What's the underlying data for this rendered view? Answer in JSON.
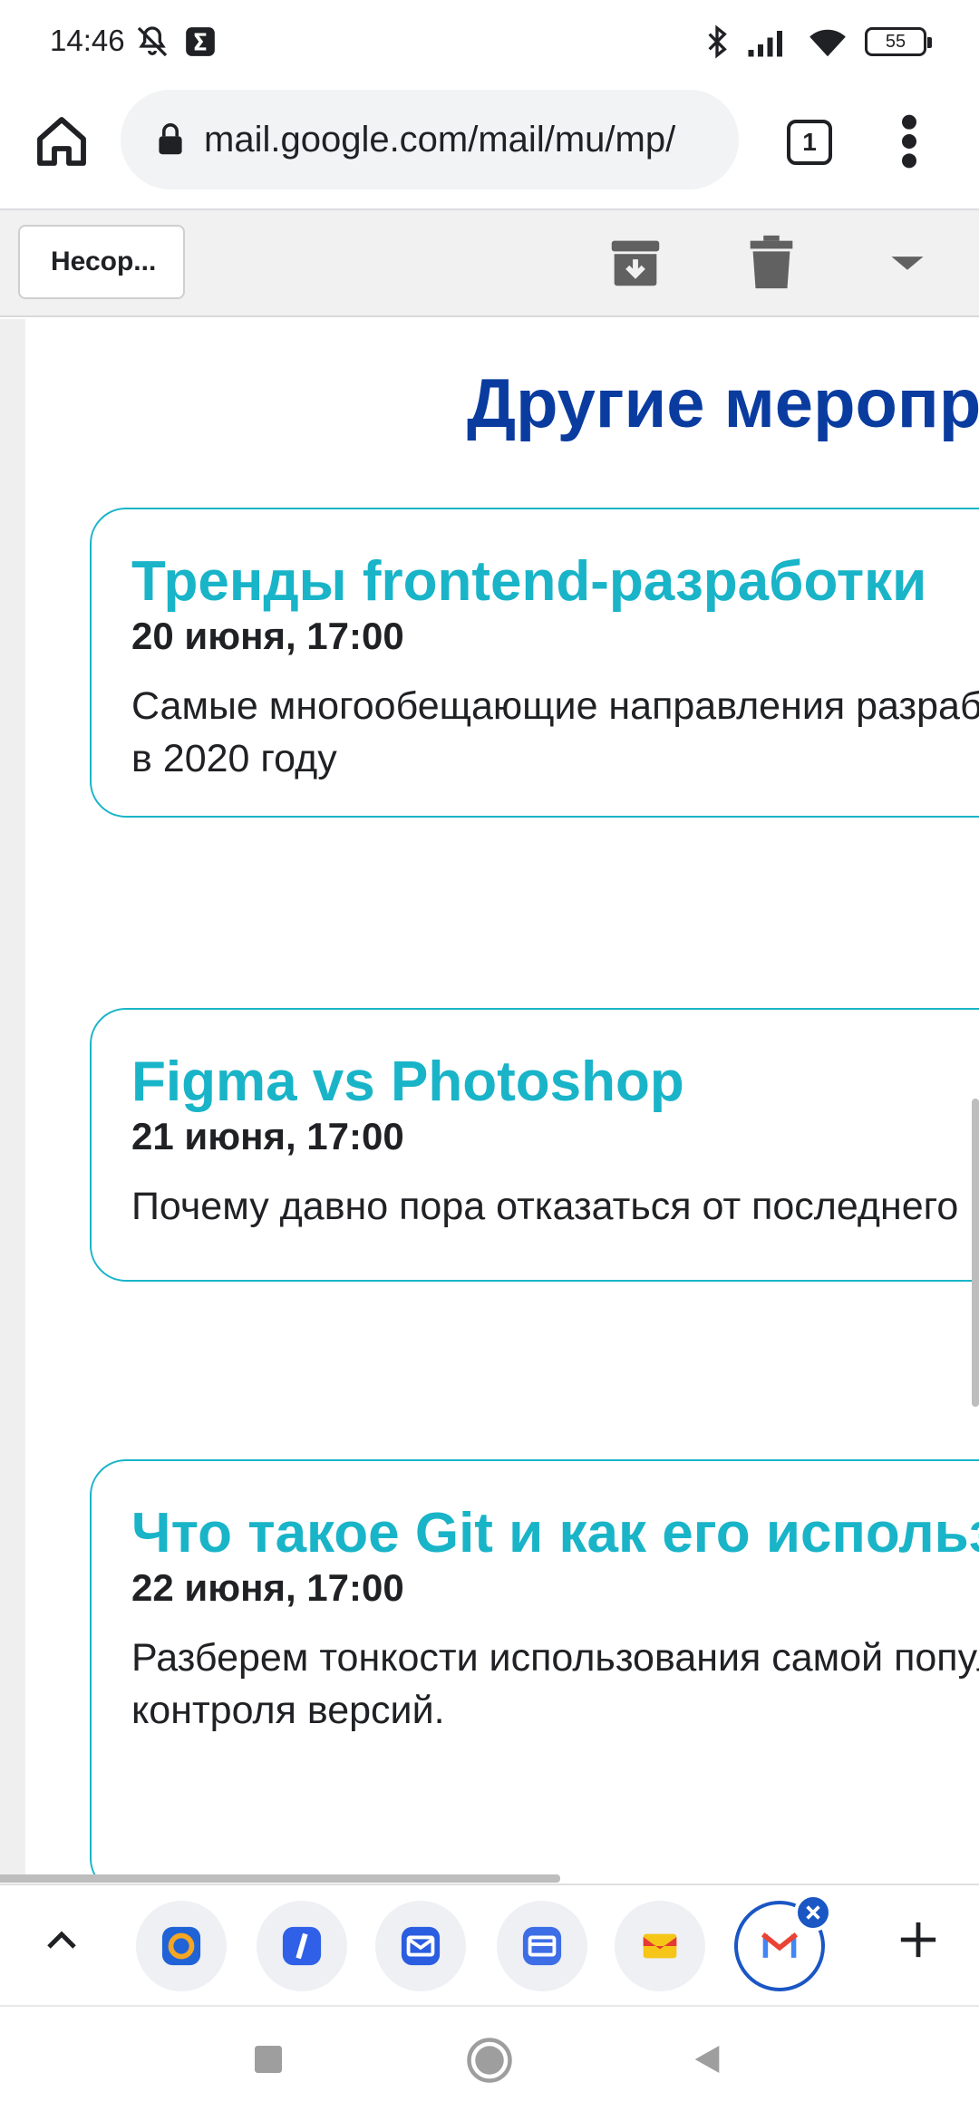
{
  "status_bar": {
    "time": "14:46",
    "battery": "55",
    "icons": [
      "mute-icon",
      "app-notification-icon",
      "bluetooth-icon",
      "signal-icon",
      "wifi-icon",
      "battery-icon"
    ]
  },
  "browser": {
    "url": "mail.google.com/mail/mu/mp/",
    "tab_count": "1"
  },
  "gmail_bar": {
    "back_label": "Несор..."
  },
  "email": {
    "section_title": "Другие мероприятия",
    "cards": [
      {
        "title": "Тренды frontend-разработки",
        "date": "20 июня, 17:00",
        "desc_line1": "Самые многообещающие направления разработки",
        "desc_line2": "в 2020 году"
      },
      {
        "title": "Figma vs Photoshop",
        "date": "21 июня, 17:00",
        "desc_line1": "Почему давно пора отказаться от последнего"
      },
      {
        "title": "Что такое Git и как его использовать",
        "date": "22 июня, 17:00",
        "desc_line1": "Разберем тонкости использования самой популярной системы",
        "desc_line2": "контроля версий."
      }
    ]
  },
  "colors": {
    "title_blue": "#0a3ca0",
    "accent_teal": "#19b4c8",
    "active_tab_blue": "#1a56c4"
  }
}
